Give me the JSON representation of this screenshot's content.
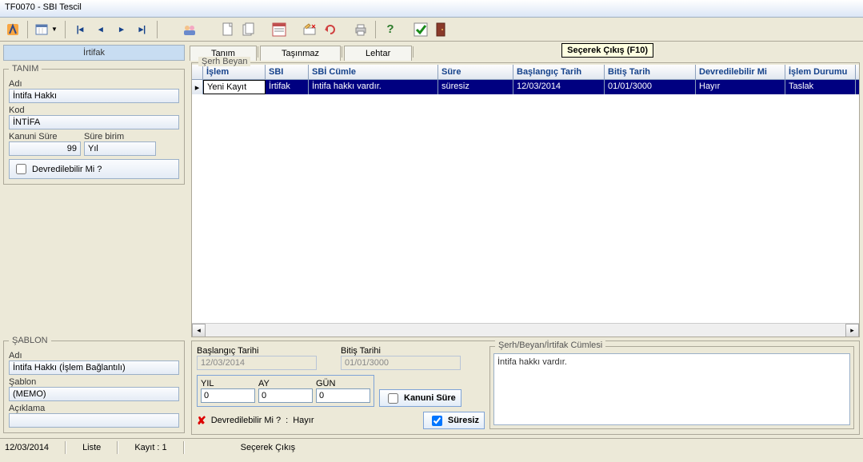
{
  "window": {
    "title": "TF0070 - SBI Tescil"
  },
  "left": {
    "header": "İrtifak",
    "tanim_legend": "TANIM",
    "adi_label": "Adı",
    "adi_value": "İntifa Hakkı",
    "kod_label": "Kod",
    "kod_value": "İNTİFA",
    "kanuni_label": "Kanuni Süre",
    "kanuni_value": "99",
    "sure_birim_label": "Süre birim",
    "sure_birim_value": "Yıl",
    "devredilebilir_label": "Devredilebilir Mi ?",
    "sablon_legend": "ŞABLON",
    "s_adi_label": "Adı",
    "s_adi_value": "İntifa Hakkı (İşlem Bağlantılı)",
    "sablon_label": "Şablon",
    "sablon_value": "(MEMO)",
    "aciklama_label": "Açıklama",
    "aciklama_value": ""
  },
  "tabs": {
    "t1": "Tanım",
    "t2": "Taşınmaz",
    "t3": "Lehtar",
    "t4": ""
  },
  "tooltip": "Seçerek Çıkış (F10)",
  "grid": {
    "legend": "Şerh Beyan",
    "headers": {
      "islem": "İşlem",
      "sbi": "SBI",
      "cumle": "SBİ Cümle",
      "sure": "Süre",
      "bas": "Başlangıç Tarih",
      "bit": "Bitiş Tarih",
      "dev": "Devredilebilir Mi",
      "dur": "İşlem Durumu"
    },
    "row": {
      "islem": "Yeni Kayıt",
      "sbi": "İrtifak",
      "cumle": "İntifa hakkı vardır.",
      "sure": "süresiz",
      "bas": "12/03/2014",
      "bit": "01/01/3000",
      "dev": "Hayır",
      "dur": "Taslak"
    }
  },
  "detail": {
    "bas_label": "Başlangıç Tarihi",
    "bas_value": "12/03/2014",
    "bit_label": "Bitiş Tarihi",
    "bit_value": "01/01/3000",
    "yil_label": "YIL",
    "yil_value": "0",
    "ay_label": "AY",
    "ay_value": "0",
    "gun_label": "GÜN",
    "gun_value": "0",
    "kanuni_btn": "Kanuni Süre",
    "dev_label": "Devredilebilir Mi ?",
    "dev_sep": ":",
    "dev_value": "Hayır",
    "suresiz_btn": "Süresiz",
    "cumle_label": "Şerh/Beyan/İrtifak Cümlesi",
    "cumle_value": "İntifa hakkı vardır."
  },
  "status": {
    "date": "12/03/2014",
    "liste": "Liste",
    "kayit": "Kayıt : 1",
    "hint": "Seçerek Çıkış"
  }
}
